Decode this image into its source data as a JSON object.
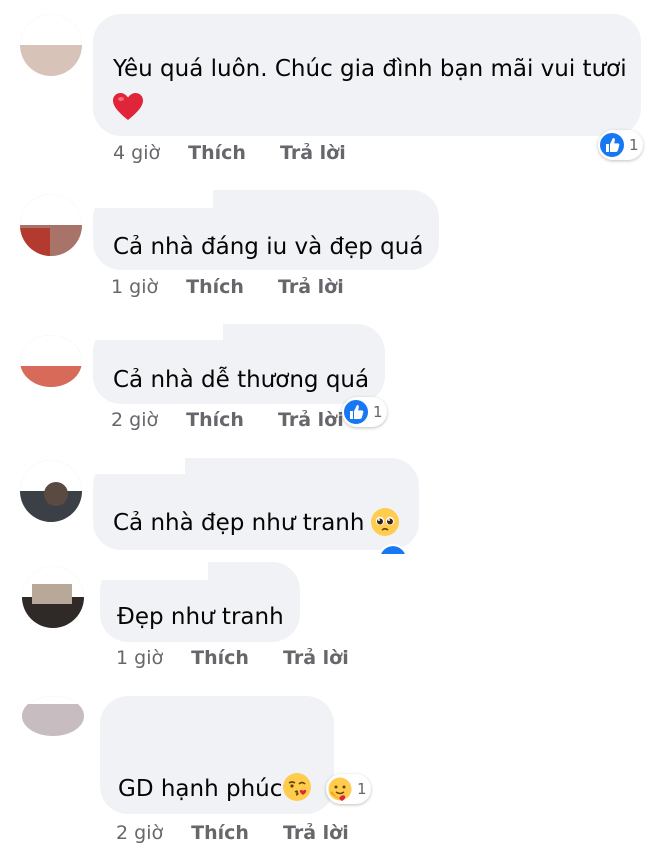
{
  "comments": [
    {
      "text": "Yêu quá luôn. Chúc gia đình bạn mãi vui tươi",
      "time": "4 giờ",
      "like": "Thích",
      "reply": "Trả lời",
      "reaction": {
        "icon": "like-icon",
        "count": "1"
      }
    },
    {
      "text": "Cả nhà đáng iu và đẹp quá",
      "time": "1 giờ",
      "like": "Thích",
      "reply": "Trả lời"
    },
    {
      "text": "Cả nhà dễ thương quá",
      "time": "2 giờ",
      "like": "Thích",
      "reply": "Trả lời",
      "reaction": {
        "icon": "like-icon",
        "count": "1"
      }
    },
    {
      "text": "Cả nhà đẹp như tranh"
    },
    {
      "text": "Đẹp như tranh",
      "time": "1 giờ",
      "like": "Thích",
      "reply": "Trả lời"
    },
    {
      "text": "GD hạnh phúc",
      "time": "2 giờ",
      "like": "Thích",
      "reply": "Trả lời",
      "reaction": {
        "icon": "care-icon",
        "count": "1"
      }
    }
  ],
  "colors": {
    "bubble": "#f0f2f5",
    "meta_text": "#65676b",
    "like_blue": "#1877f2",
    "heart_red": "#e0243a",
    "emoji_yellow": "#ffcc4d"
  }
}
